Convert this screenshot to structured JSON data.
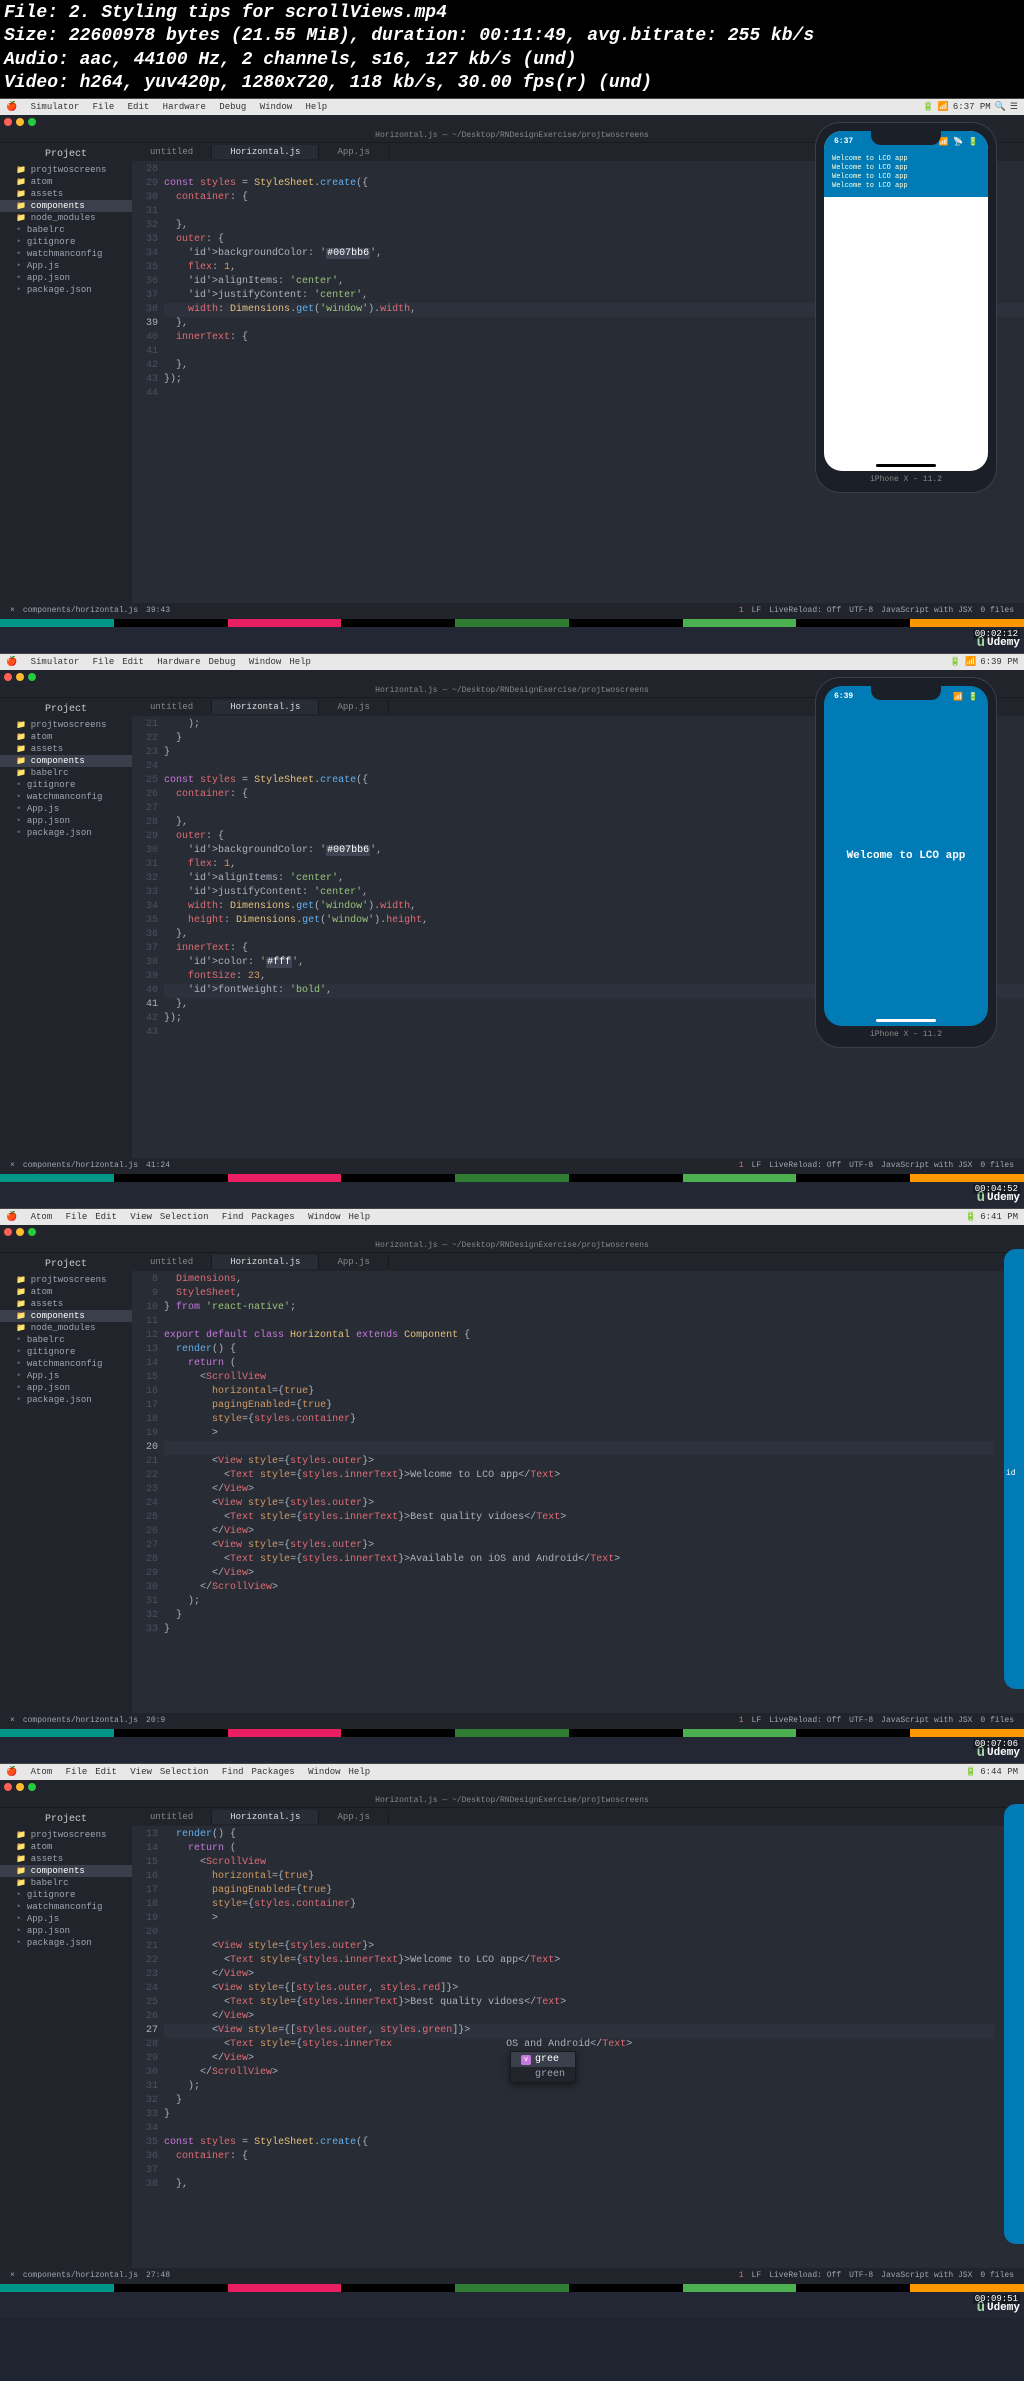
{
  "meta": {
    "l1": "File: 2. Styling tips for scrollViews.mp4",
    "l2": "Size: 22600978 bytes (21.55 MiB), duration: 00:11:49, avg.bitrate: 255 kb/s",
    "l3": "Audio: aac, 44100 Hz, 2 channels, s16, 127 kb/s (und)",
    "l4": "Video: h264, yuv420p, 1280x720, 118 kb/s, 30.00 fps(r) (und)"
  },
  "menu_sim": {
    "app": "Simulator",
    "items": [
      "File",
      "Edit",
      "Hardware",
      "Debug",
      "Window",
      "Help"
    ]
  },
  "menu_atom": {
    "app": "Atom",
    "items": [
      "File",
      "Edit",
      "View",
      "Selection",
      "Find",
      "Packages",
      "Window",
      "Help"
    ]
  },
  "mac_time": {
    "f1": "6:37 PM",
    "f2": "6:39 PM",
    "f3": "6:41 PM",
    "f4": "6:44 PM"
  },
  "sidebar_hdr": "Project",
  "sidebar": {
    "root": "projtwoscreens",
    "items": [
      "atom",
      "assets",
      "components",
      "node_modules",
      "babelrc",
      "gitignore",
      "watchmanconfig",
      "App.js",
      "app.json",
      "package.json"
    ],
    "items2": [
      "atom",
      "assets",
      "components",
      "babelrc",
      "gitignore",
      "watchmanconfig",
      "App.js",
      "app.json",
      "package.json"
    ]
  },
  "tabs": {
    "t1": "untitled",
    "t2": "Horizontal.js",
    "t3": "App.js"
  },
  "pathbar": "Horizontal.js — ~/Desktop/RNDesignExercise/projtwoscreens",
  "status": {
    "left1": "components/horizontal.js",
    "pos1": "39:43",
    "pos2": "41:24",
    "pos3": "20:9",
    "pos4": "27:48",
    "lf": "LF",
    "live": "LiveReload: Off",
    "utf": "UTF-8",
    "lang": "JavaScript with JSX",
    "files": "0 files",
    "git": "1"
  },
  "iphone_label": "iPhone X – 11.2",
  "phone1": {
    "time": "6:37",
    "lines": [
      "Welcome to LCO app",
      "Welcome to LCO app",
      "Welcome to LCO app",
      "Welcome to LCO app"
    ]
  },
  "phone2": {
    "time": "6:39",
    "text": "Welcome to LCO app"
  },
  "frame3_sidetext": "id",
  "udemy": "Udemy",
  "timestamps": {
    "f1": "00:02:12",
    "f2": "00:04:52",
    "f3": "00:07:06",
    "f4": "00:09:51"
  },
  "colors_bar": [
    "#009688",
    "#000",
    "#e91e63",
    "#000",
    "#2e7d32",
    "#000",
    "#4caf50",
    "#000",
    "#ff9800"
  ],
  "autocomplete": {
    "typed": "gree",
    "opts": [
      "gree",
      "green"
    ]
  },
  "f1_code": {
    "start": 28,
    "curr": 39,
    "lines": [
      {
        "t": ""
      },
      {
        "t": "const styles = StyleSheet.create({",
        "cls": "s1"
      },
      {
        "t": "  container: {",
        "cls": "s2"
      },
      {
        "t": ""
      },
      {
        "t": "  },",
        "cls": "pn"
      },
      {
        "t": "  outer: {",
        "cls": "s2"
      },
      {
        "t": "    backgroundColor: '#007bb6',",
        "cls": "s3",
        "hl": "#007bb6"
      },
      {
        "t": "    flex: 1,",
        "cls": "s4"
      },
      {
        "t": "    alignItems: 'center',",
        "cls": "s3"
      },
      {
        "t": "    justifyContent: 'center',",
        "cls": "s3"
      },
      {
        "t": "    width: Dimensions.get('window').width,",
        "cls": "s5",
        "curr": true
      },
      {
        "t": "  },",
        "cls": "pn"
      },
      {
        "t": "  innerText: {",
        "cls": "s2"
      },
      {
        "t": ""
      },
      {
        "t": "  },",
        "cls": "pn"
      },
      {
        "t": "});",
        "cls": "pn"
      },
      {
        "t": ""
      }
    ]
  },
  "f2_code": {
    "start": 21,
    "curr": 41,
    "lines": [
      {
        "t": "    );"
      },
      {
        "t": "  }"
      },
      {
        "t": "}"
      },
      {
        "t": ""
      },
      {
        "t": "const styles = StyleSheet.create({",
        "cls": "s1"
      },
      {
        "t": "  container: {",
        "cls": "s2"
      },
      {
        "t": ""
      },
      {
        "t": "  },",
        "cls": "pn"
      },
      {
        "t": "  outer: {",
        "cls": "s2"
      },
      {
        "t": "    backgroundColor: '#007bb6',",
        "cls": "s3",
        "hl": "#007bb6"
      },
      {
        "t": "    flex: 1,",
        "cls": "s4"
      },
      {
        "t": "    alignItems: 'center',",
        "cls": "s3"
      },
      {
        "t": "    justifyContent: 'center',",
        "cls": "s3"
      },
      {
        "t": "    width: Dimensions.get('window').width,",
        "cls": "s5"
      },
      {
        "t": "    height: Dimensions.get('window').height,",
        "cls": "s5"
      },
      {
        "t": "  },",
        "cls": "pn"
      },
      {
        "t": "  innerText: {",
        "cls": "s2"
      },
      {
        "t": "    color: '#fff',",
        "cls": "s3",
        "hl": "#fff"
      },
      {
        "t": "    fontSize: 23,",
        "cls": "s4"
      },
      {
        "t": "    fontWeight: 'bold',",
        "cls": "s3",
        "curr": true
      },
      {
        "t": "  },",
        "cls": "pn"
      },
      {
        "t": "});",
        "cls": "pn"
      },
      {
        "t": ""
      }
    ]
  },
  "f3_code": {
    "start": 8,
    "curr": 20,
    "html": [
      "  <span class='id'>Dimensions</span>,",
      "  <span class='id'>StyleSheet</span>,",
      "} <span class='kw'>from</span> <span class='str'>'react-native'</span>;",
      "",
      "<span class='kw'>export default class</span> <span class='prop'>Horizontal</span> <span class='kw'>extends</span> <span class='prop'>Component</span> {",
      "  <span class='fn'>render</span>() {",
      "    <span class='kw'>return</span> (",
      "      &lt;<span class='tag'>ScrollView</span>",
      "        <span class='attr'>horizontal</span>=<span class='pn'>{</span><span class='num'>true</span><span class='pn'>}</span>",
      "        <span class='attr'>pagingEnabled</span>=<span class='pn'>{</span><span class='num'>true</span><span class='pn'>}</span>",
      "        <span class='attr'>style</span>=<span class='pn'>{</span><span class='id'>styles</span>.<span class='id'>container</span><span class='pn'>}</span>",
      "        &gt;",
      "",
      "        &lt;<span class='tag'>View</span> <span class='attr'>style</span>=<span class='pn'>{</span><span class='id'>styles</span>.<span class='id'>outer</span><span class='pn'>}</span>&gt;",
      "          &lt;<span class='tag'>Text</span> <span class='attr'>style</span>=<span class='pn'>{</span><span class='id'>styles</span>.<span class='id'>innerText</span><span class='pn'>}</span>&gt;Welcome to LCO app&lt;/<span class='tag'>Text</span>&gt;",
      "        &lt;/<span class='tag'>View</span>&gt;",
      "        &lt;<span class='tag'>View</span> <span class='attr'>style</span>=<span class='pn'>{</span><span class='id'>styles</span>.<span class='id'>outer</span><span class='pn'>}</span>&gt;",
      "          &lt;<span class='tag'>Text</span> <span class='attr'>style</span>=<span class='pn'>{</span><span class='id'>styles</span>.<span class='id'>innerText</span><span class='pn'>}</span>&gt;Best quality vidoes&lt;/<span class='tag'>Text</span>&gt;",
      "        &lt;/<span class='tag'>View</span>&gt;",
      "        &lt;<span class='tag'>View</span> <span class='attr'>style</span>=<span class='pn'>{</span><span class='id'>styles</span>.<span class='id'>outer</span><span class='pn'>}</span>&gt;",
      "          &lt;<span class='tag'>Text</span> <span class='attr'>style</span>=<span class='pn'>{</span><span class='id'>styles</span>.<span class='id'>innerText</span><span class='pn'>}</span>&gt;Available on iOS and Android&lt;/<span class='tag'>Text</span>&gt;",
      "        &lt;/<span class='tag'>View</span>&gt;",
      "      &lt;/<span class='tag'>ScrollView</span>&gt;",
      "    );",
      "  }",
      "}"
    ]
  },
  "f4_code": {
    "start": 13,
    "curr": 27,
    "html": [
      "  <span class='fn'>render</span>() {",
      "    <span class='kw'>return</span> (",
      "      &lt;<span class='tag'>ScrollView</span>",
      "        <span class='attr'>horizontal</span>=<span class='pn'>{</span><span class='num'>true</span><span class='pn'>}</span>",
      "        <span class='attr'>pagingEnabled</span>=<span class='pn'>{</span><span class='num'>true</span><span class='pn'>}</span>",
      "        <span class='attr'>style</span>=<span class='pn'>{</span><span class='id'>styles</span>.<span class='id'>container</span><span class='pn'>}</span>",
      "        &gt;",
      "",
      "        &lt;<span class='tag'>View</span> <span class='attr'>style</span>=<span class='pn'>{</span><span class='id'>styles</span>.<span class='id'>outer</span><span class='pn'>}</span>&gt;",
      "          &lt;<span class='tag'>Text</span> <span class='attr'>style</span>=<span class='pn'>{</span><span class='id'>styles</span>.<span class='id'>innerText</span><span class='pn'>}</span>&gt;Welcome to LCO app&lt;/<span class='tag'>Text</span>&gt;",
      "        &lt;/<span class='tag'>View</span>&gt;",
      "        &lt;<span class='tag'>View</span> <span class='attr'>style</span>=<span class='pn'>{[</span><span class='id'>styles</span>.<span class='id'>outer</span>, <span class='id'>styles</span>.<span class='id'>red</span><span class='pn'>]}</span>&gt;",
      "          &lt;<span class='tag'>Text</span> <span class='attr'>style</span>=<span class='pn'>{</span><span class='id'>styles</span>.<span class='id'>innerText</span><span class='pn'>}</span>&gt;Best quality vidoes&lt;/<span class='tag'>Text</span>&gt;",
      "        &lt;/<span class='tag'>View</span>&gt;",
      "        &lt;<span class='tag'>View</span> <span class='attr'>style</span>=<span class='pn'>{[</span><span class='id'>styles</span>.<span class='id'>outer</span>, <span class='id'>styles</span>.<span class='id'>green</span><span class='pn'>]}</span>&gt;",
      "          &lt;<span class='tag'>Text</span> <span class='attr'>style</span>=<span class='pn'>{</span><span class='id'>styles</span>.<span class='id'>innerTex</span><span class='pn'>  </span>                 OS and Android&lt;/<span class='tag'>Text</span>&gt;",
      "        &lt;/<span class='tag'>View</span>&gt;",
      "      &lt;/<span class='tag'>ScrollView</span>&gt;",
      "    );",
      "  }",
      "}",
      "",
      "<span class='kw'>const</span> <span class='id'>styles</span> = <span class='prop'>StyleSheet</span>.<span class='fn'>create</span>({",
      "  <span class='id'>container</span>: {",
      "",
      "  },"
    ]
  }
}
